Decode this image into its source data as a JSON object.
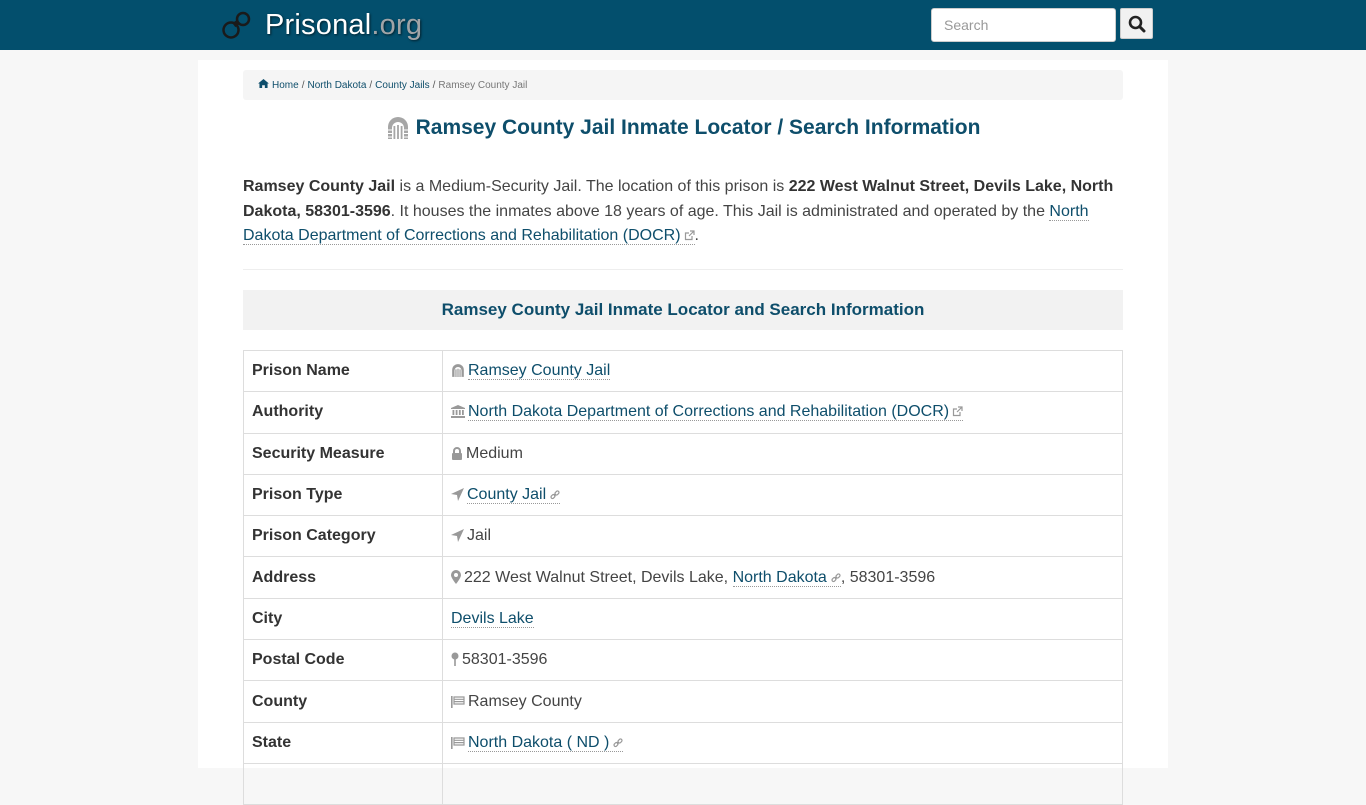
{
  "header": {
    "logo_main": "Prisonal",
    "logo_tld": ".org",
    "logo_icon": "handcuffs-icon",
    "search_placeholder": "Search",
    "search_button_icon": "search-icon",
    "brand_color": "#034f6d"
  },
  "breadcrumb": {
    "items": [
      {
        "label": "Home",
        "icon": "home-icon"
      },
      {
        "label": "North Dakota"
      },
      {
        "label": "County Jails"
      }
    ],
    "current": "Ramsey County Jail",
    "separator": "/"
  },
  "title": {
    "text": "Ramsey County Jail Inmate Locator / Search Information",
    "icon": "prison-gate-icon"
  },
  "intro": {
    "name": "Ramsey County Jail",
    "t1": " is a Medium-Security Jail. The location of this prison is ",
    "address": "222 West Walnut Street, Devils Lake, North Dakota, 58301-3596",
    "t2": ". It houses the inmates above 18 years of age. This Jail is administrated and operated by the ",
    "authority_link": "North Dakota Department of Corrections and Rehabilitation (DOCR)",
    "t3": "."
  },
  "section": {
    "heading": "Ramsey County Jail Inmate Locator and Search Information"
  },
  "table": {
    "rows": [
      {
        "label": "Prison Name",
        "value": "Ramsey County Jail",
        "icon": "prison-gate-icon",
        "link": true
      },
      {
        "label": "Authority",
        "value": "North Dakota Department of Corrections and Rehabilitation (DOCR)",
        "icon": "institution-icon",
        "link": true,
        "external": true
      },
      {
        "label": "Security Measure",
        "value": "Medium",
        "icon": "lock-icon"
      },
      {
        "label": "Prison Type",
        "value": "County Jail",
        "icon": "location-arrow-icon",
        "link": true,
        "chain": true
      },
      {
        "label": "Prison Category",
        "value": "Jail",
        "icon": "location-arrow-icon"
      },
      {
        "label": "Address",
        "value_prefix": "222 West Walnut Street, Devils Lake, ",
        "value_link": "North Dakota",
        "value_suffix": ", 58301-3596",
        "icon": "map-marker-icon"
      },
      {
        "label": "City",
        "value": "Devils Lake",
        "link": true
      },
      {
        "label": "Postal Code",
        "value": "58301-3596",
        "icon": "map-pin-icon"
      },
      {
        "label": "County",
        "value": "Ramsey County",
        "icon": "flag-icon"
      },
      {
        "label": "State",
        "value": "North Dakota ( ND )",
        "icon": "flag-icon",
        "link": true,
        "chain": true
      }
    ]
  }
}
